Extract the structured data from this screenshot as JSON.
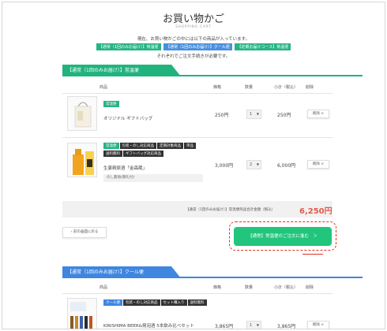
{
  "header": {
    "title": "お買い物かご",
    "subtitle": "SHOPPING CART",
    "intro": "現在、お買い物かごの中には以下の商品が入っています。",
    "tag_normal": "【通常（1回のみお届け）】常温便",
    "tag_cool": "【通常（1回のみお届け）】クール便",
    "tag_teiki": "【定期お届けコース】常温便",
    "intro2": "それぞれでご注文手続きが必要です。"
  },
  "section_normal": {
    "title": "【通常（1回のみお届け）】常温便",
    "columns": {
      "product": "商品",
      "price": "価格",
      "qty": "数量",
      "subtotal": "小計（税込）",
      "delete": "削除"
    },
    "items": [
      {
        "badges": [
          "常温便"
        ],
        "name": "オリジナル ギフトバッグ",
        "price": "250円",
        "qty": "1",
        "subtotal": "250円",
        "delete": "削除 ×"
      },
      {
        "badges": [
          "常温便",
          "包装・のし対応商品",
          "定期対象商品",
          "単品",
          "送料無料",
          "ギフトバッグ対応商品"
        ],
        "name": "生姜麹原酒「金森蔵」",
        "noshi": "のし無地(御礼付)",
        "price": "3,000円",
        "qty": "2",
        "subtotal": "6,000円",
        "delete": "削除 ×"
      }
    ],
    "total_label": "【通常（1回のみお届け）】常温便商品合計金額（税込）",
    "total_value": "6,250円",
    "back_label": "前の画面に戻る",
    "next_label": "【通常】常温便のご注文に進む　＞"
  },
  "section_cool": {
    "title": "【通常（1回のみお届け）】クール便",
    "columns": {
      "product": "商品",
      "price": "価格",
      "qty": "数量",
      "subtotal": "小計（税込）",
      "delete": "削除"
    },
    "items": [
      {
        "badges": [
          "クール便",
          "包装・のし対応商品",
          "セット購入り",
          "送料無料"
        ],
        "name": "KIRISHIMA BEER&発泡酒 5本飲み比べセット",
        "price": "3,865円",
        "qty": "1",
        "subtotal": "3,865円",
        "delete": "削除 ×"
      }
    ]
  },
  "colors": {
    "green": "#21b37e",
    "blue": "#3f86e0",
    "accent_red": "#e0301e",
    "price_red": "#e25b4a"
  }
}
